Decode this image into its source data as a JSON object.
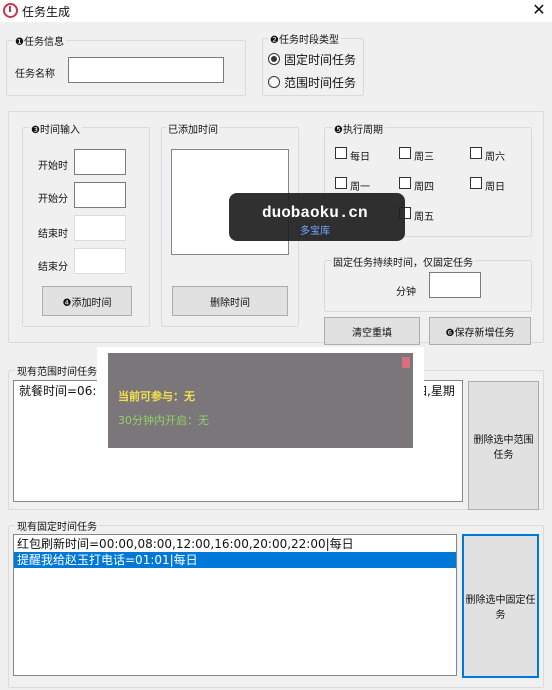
{
  "window": {
    "title": "任务生成",
    "close_glyph": "✕"
  },
  "task_info": {
    "group_label": "❶任务信息",
    "name_label": "任务名称",
    "name_value": ""
  },
  "period_type": {
    "group_label": "❷任务时段类型",
    "options": [
      {
        "label": "固定时间任务",
        "selected": true
      },
      {
        "label": "范围时间任务",
        "selected": false
      }
    ]
  },
  "time_input": {
    "group_label": "❸时间输入",
    "start_hour_label": "开始时",
    "start_minute_label": "开始分",
    "end_hour_label": "结束时",
    "end_minute_label": "结束分",
    "add_button": "❹添加时间"
  },
  "added_time": {
    "group_label": "已添加时间",
    "remove_button": "删除时间"
  },
  "exec_cycle": {
    "group_label": "❺执行周期",
    "days": [
      "每日",
      "周三",
      "周六",
      "周一",
      "周四",
      "周日",
      "周五"
    ]
  },
  "fixed_duration": {
    "group_label": "固定任务持续时间，仅固定任务",
    "unit_label": "分钟",
    "value": ""
  },
  "actions": {
    "clear_button": "清空重填",
    "save_button": "❻保存新增任务"
  },
  "range_tasks": {
    "group_label": "现有范围时间任务",
    "items": [
      "就餐时间=06:0"
    ],
    "overflow_fragment": "四,星期",
    "delete_button": "删除选中范围任务"
  },
  "fixed_tasks": {
    "group_label": "现有固定时间任务",
    "items": [
      {
        "text": "红包刷新时间=00:00,08:00,12:00,16:00,20:00,22:00|每日",
        "selected": false
      },
      {
        "text": "提醒我给赵玉打电话=01:01|每日",
        "selected": true
      }
    ],
    "delete_button": "删除选中固定任务"
  },
  "popup": {
    "line1": "当前可参与：无",
    "line2": "30分钟内开启：无"
  },
  "watermark": {
    "domain": "duobaoku.cn",
    "subtitle": "多宝库"
  }
}
